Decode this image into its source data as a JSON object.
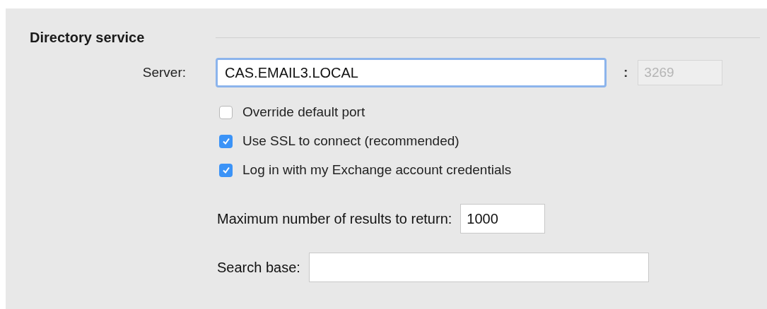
{
  "section": {
    "title": "Directory service"
  },
  "server": {
    "label": "Server:",
    "value": "CAS.EMAIL3.LOCAL",
    "focused": true,
    "separator": ":",
    "port": {
      "value": "3269",
      "disabled": true
    }
  },
  "options": [
    {
      "label": "Override default port",
      "checked": false
    },
    {
      "label": "Use SSL to connect (recommended)",
      "checked": true
    },
    {
      "label": "Log in with my Exchange account credentials",
      "checked": true
    }
  ],
  "max_results": {
    "label": "Maximum number of results to return:",
    "value": "1000"
  },
  "search_base": {
    "label": "Search base:"
  }
}
